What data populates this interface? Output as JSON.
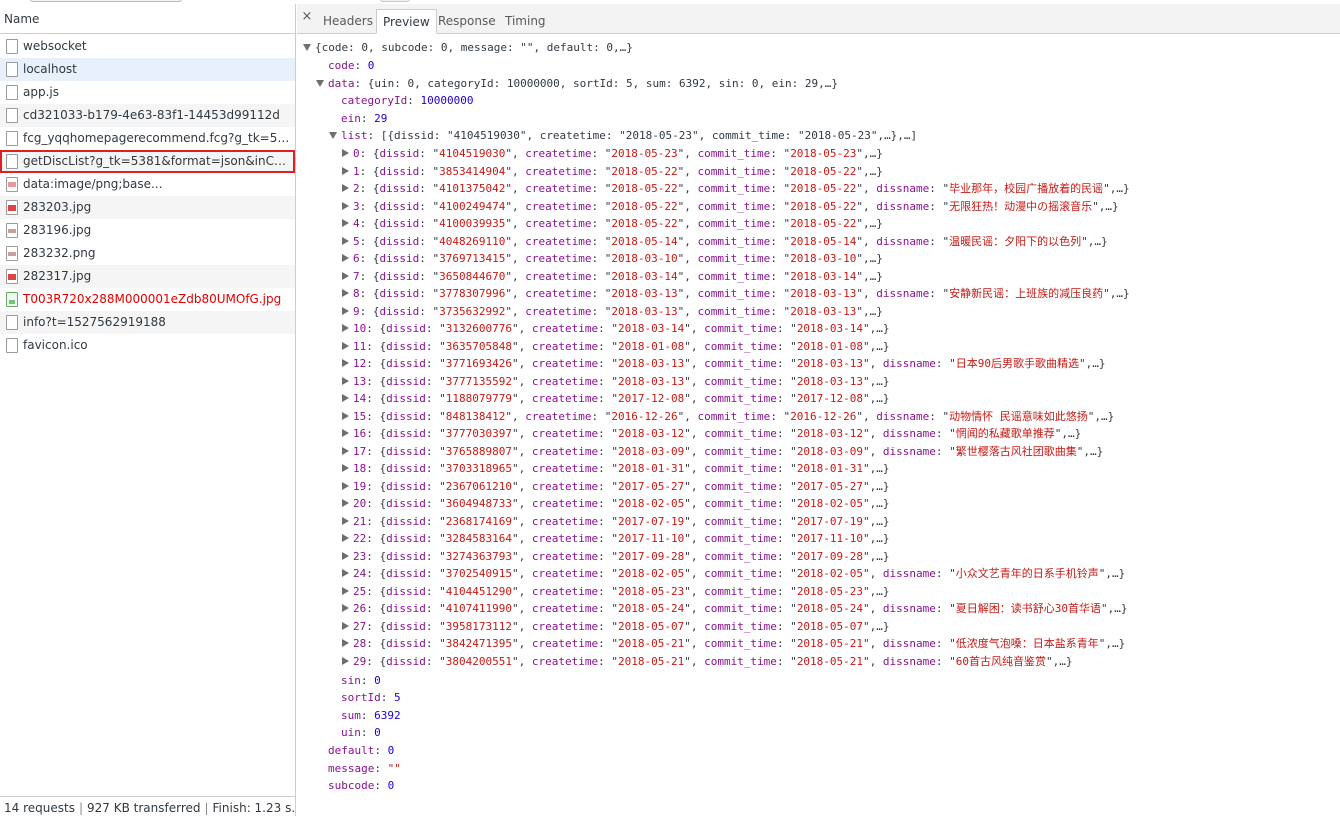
{
  "requests": {
    "header": "Name",
    "items": [
      {
        "name": "websocket",
        "icon": "file-icon"
      },
      {
        "name": "localhost",
        "icon": "file-icon"
      },
      {
        "name": "app.js",
        "icon": "file-icon"
      },
      {
        "name": "cd321033-b179-4e63-83f1-14453d99112d",
        "icon": "file-icon"
      },
      {
        "name": "fcg_yqqhomepagerecommend.fcg?g_tk=53...",
        "icon": "file-icon"
      },
      {
        "name": "getDiscList?g_tk=5381&format=json&inCha...",
        "icon": "file-icon"
      },
      {
        "name": "data:image/png;base...",
        "icon": "image-icon"
      },
      {
        "name": "283203.jpg",
        "icon": "image-icon"
      },
      {
        "name": "283196.jpg",
        "icon": "image-icon"
      },
      {
        "name": "283232.png",
        "icon": "image-icon"
      },
      {
        "name": "282317.jpg",
        "icon": "image-icon"
      },
      {
        "name": "T003R720x288M000001eZdb80UMOfG.jpg",
        "icon": "broken-image-icon"
      },
      {
        "name": "info?t=1527562919188",
        "icon": "file-icon"
      },
      {
        "name": "favicon.ico",
        "icon": "file-icon"
      }
    ],
    "status": {
      "requests": "14 requests",
      "transferred": "927 KB transferred",
      "finish": "Finish: 1.23 s..."
    }
  },
  "detail": {
    "close": "×",
    "tabs": {
      "headers": "Headers",
      "preview": "Preview",
      "response": "Response",
      "timing": "Timing"
    },
    "active_tab": "Preview"
  },
  "preview": {
    "root_summary": "{code: 0, subcode: 0, message: \"\", default: 0,…}",
    "code": {
      "key": "code",
      "value": "0"
    },
    "data": {
      "key": "data",
      "summary": "{uin: 0, categoryId: 10000000, sortId: 5, sum: 6392, sin: 0, ein: 29,…}",
      "categoryId": {
        "key": "categoryId",
        "value": "10000000"
      },
      "ein": {
        "key": "ein",
        "value": "29"
      },
      "list": {
        "key": "list",
        "summary": "[{dissid: \"4104519030\", createtime: \"2018-05-23\", commit_time: \"2018-05-23\",…},…]",
        "items": [
          {
            "i": "0",
            "dissid": "4104519030",
            "createtime": "2018-05-23",
            "commit_time": "2018-05-23",
            "dissname": ""
          },
          {
            "i": "1",
            "dissid": "3853414904",
            "createtime": "2018-05-22",
            "commit_time": "2018-05-22",
            "dissname": ""
          },
          {
            "i": "2",
            "dissid": "4101375042",
            "createtime": "2018-05-22",
            "commit_time": "2018-05-22",
            "dissname": "毕业那年，校园广播放着的民谣"
          },
          {
            "i": "3",
            "dissid": "4100249474",
            "createtime": "2018-05-22",
            "commit_time": "2018-05-22",
            "dissname": "无限狂热！动漫中の摇滚音乐"
          },
          {
            "i": "4",
            "dissid": "4100039935",
            "createtime": "2018-05-22",
            "commit_time": "2018-05-22",
            "dissname": ""
          },
          {
            "i": "5",
            "dissid": "4048269110",
            "createtime": "2018-05-14",
            "commit_time": "2018-05-14",
            "dissname": "温暖民谣：夕阳下的以色列"
          },
          {
            "i": "6",
            "dissid": "3769713415",
            "createtime": "2018-03-10",
            "commit_time": "2018-03-10",
            "dissname": ""
          },
          {
            "i": "7",
            "dissid": "3650844670",
            "createtime": "2018-03-14",
            "commit_time": "2018-03-14",
            "dissname": ""
          },
          {
            "i": "8",
            "dissid": "3778307996",
            "createtime": "2018-03-13",
            "commit_time": "2018-03-13",
            "dissname": "安静新民谣：上班族的减压良药"
          },
          {
            "i": "9",
            "dissid": "3735632992",
            "createtime": "2018-03-13",
            "commit_time": "2018-03-13",
            "dissname": ""
          },
          {
            "i": "10",
            "dissid": "3132600776",
            "createtime": "2018-03-14",
            "commit_time": "2018-03-14",
            "dissname": ""
          },
          {
            "i": "11",
            "dissid": "3635705848",
            "createtime": "2018-01-08",
            "commit_time": "2018-01-08",
            "dissname": ""
          },
          {
            "i": "12",
            "dissid": "3771693426",
            "createtime": "2018-03-13",
            "commit_time": "2018-03-13",
            "dissname": "日本90后男歌手歌曲精选"
          },
          {
            "i": "13",
            "dissid": "3777135592",
            "createtime": "2018-03-13",
            "commit_time": "2018-03-13",
            "dissname": ""
          },
          {
            "i": "14",
            "dissid": "1188079779",
            "createtime": "2017-12-08",
            "commit_time": "2017-12-08",
            "dissname": ""
          },
          {
            "i": "15",
            "dissid": "848138412",
            "createtime": "2016-12-26",
            "commit_time": "2016-12-26",
            "dissname": "动物情怀 民谣意味如此悠扬"
          },
          {
            "i": "16",
            "dissid": "3777030397",
            "createtime": "2018-03-12",
            "commit_time": "2018-03-12",
            "dissname": "惘闻的私藏歌单推荐"
          },
          {
            "i": "17",
            "dissid": "3765889807",
            "createtime": "2018-03-09",
            "commit_time": "2018-03-09",
            "dissname": "繁世樱落古风社团歌曲集"
          },
          {
            "i": "18",
            "dissid": "3703318965",
            "createtime": "2018-01-31",
            "commit_time": "2018-01-31",
            "dissname": ""
          },
          {
            "i": "19",
            "dissid": "2367061210",
            "createtime": "2017-05-27",
            "commit_time": "2017-05-27",
            "dissname": ""
          },
          {
            "i": "20",
            "dissid": "3604948733",
            "createtime": "2018-02-05",
            "commit_time": "2018-02-05",
            "dissname": ""
          },
          {
            "i": "21",
            "dissid": "2368174169",
            "createtime": "2017-07-19",
            "commit_time": "2017-07-19",
            "dissname": ""
          },
          {
            "i": "22",
            "dissid": "3284583164",
            "createtime": "2017-11-10",
            "commit_time": "2017-11-10",
            "dissname": ""
          },
          {
            "i": "23",
            "dissid": "3274363793",
            "createtime": "2017-09-28",
            "commit_time": "2017-09-28",
            "dissname": ""
          },
          {
            "i": "24",
            "dissid": "3702540915",
            "createtime": "2018-02-05",
            "commit_time": "2018-02-05",
            "dissname": "小众文艺青年的日系手机铃声"
          },
          {
            "i": "25",
            "dissid": "4104451290",
            "createtime": "2018-05-23",
            "commit_time": "2018-05-23",
            "dissname": ""
          },
          {
            "i": "26",
            "dissid": "4107411990",
            "createtime": "2018-05-24",
            "commit_time": "2018-05-24",
            "dissname": "夏日解困：读书舒心30首华语"
          },
          {
            "i": "27",
            "dissid": "3958173112",
            "createtime": "2018-05-07",
            "commit_time": "2018-05-07",
            "dissname": ""
          },
          {
            "i": "28",
            "dissid": "3842471395",
            "createtime": "2018-05-21",
            "commit_time": "2018-05-21",
            "dissname": "低浓度气泡嗓：日本盐系青年"
          },
          {
            "i": "29",
            "dissid": "3804200551",
            "createtime": "2018-05-21",
            "commit_time": "2018-05-21",
            "dissname": "60首古风纯音鉴赏"
          }
        ]
      },
      "sin": {
        "key": "sin",
        "value": "0"
      },
      "sortId": {
        "key": "sortId",
        "value": "5"
      },
      "sum": {
        "key": "sum",
        "value": "6392"
      },
      "uin": {
        "key": "uin",
        "value": "0"
      }
    },
    "default": {
      "key": "default",
      "value": "0"
    },
    "message": {
      "key": "message",
      "value": "\"\""
    },
    "subcode": {
      "key": "subcode",
      "value": "0"
    }
  },
  "colors": {
    "key": "#881391",
    "number": "#1c00cf",
    "string": "#c41a16",
    "error_text": "#e00000",
    "selected_row": "#e8f0fb",
    "highlight_box": "#e02020"
  }
}
